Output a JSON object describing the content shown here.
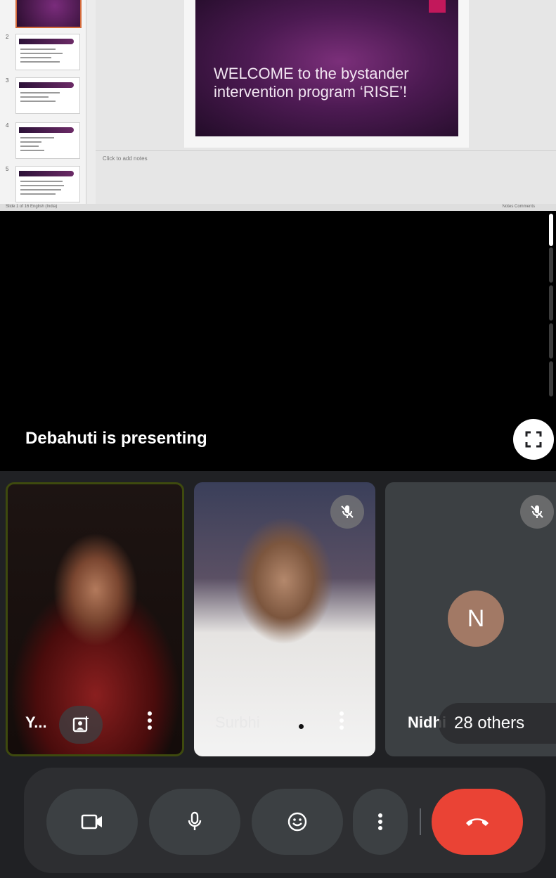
{
  "slide_panel": {
    "thumbnail_numbers": [
      "2",
      "3",
      "4",
      "5"
    ],
    "slide_title": "WELCOME to the bystander intervention program ‘RISE’!",
    "notes_placeholder": "Click to add notes",
    "status_left": "Slide 1 of 16   English (India)",
    "status_right": "Notes   Comments"
  },
  "presenting": {
    "label": "Debahuti  is presenting",
    "fullscreen_icon": "fullscreen-icon"
  },
  "participants": [
    {
      "name": "Y...",
      "icons": [
        "effects-icon",
        "more-vert-icon"
      ]
    },
    {
      "name": "Surbhi",
      "muted": true,
      "icons": [
        "mic-off-icon",
        "more-vert-icon"
      ]
    },
    {
      "name": "Nidhi",
      "initial": "N",
      "muted": true,
      "avatar_color": "#a27965",
      "icons": [
        "mic-off-icon"
      ]
    }
  ],
  "others_label": "28 others",
  "controls": [
    {
      "icon": "camera-icon"
    },
    {
      "icon": "mic-icon"
    },
    {
      "icon": "emoji-icon"
    },
    {
      "icon": "more-vert-icon"
    },
    {
      "icon": "hang-up-icon",
      "color": "#ea4335"
    }
  ]
}
